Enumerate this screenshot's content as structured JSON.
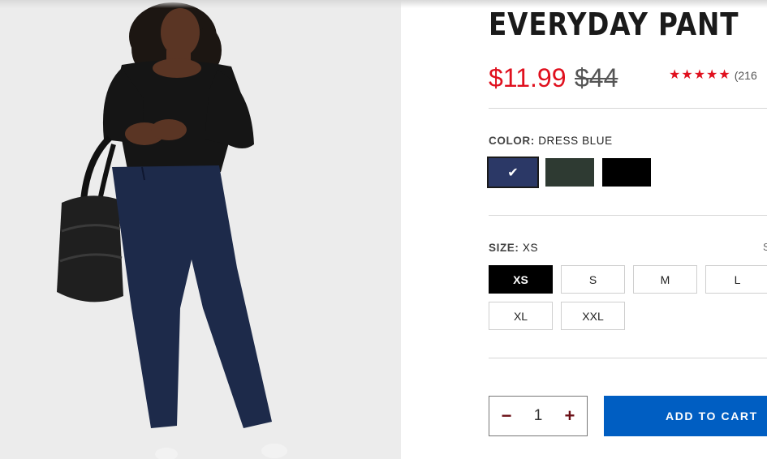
{
  "product": {
    "title": "EVERYDAY PANT",
    "sale_price": "$11.99",
    "original_price": "$44",
    "rating_stars": 5,
    "review_count": "(216"
  },
  "color": {
    "label": "COLOR:",
    "selected": "DRESS BLUE",
    "swatches": [
      {
        "name": "Dress Blue",
        "hex": "#2b3866",
        "selected": true
      },
      {
        "name": "Dark Green",
        "hex": "#2e3a32",
        "selected": false
      },
      {
        "name": "Black",
        "hex": "#000000",
        "selected": false
      }
    ]
  },
  "size": {
    "label": "SIZE:",
    "selected": "XS",
    "options": [
      "XS",
      "S",
      "M",
      "L",
      "XL",
      "XXL"
    ],
    "guide_hint": "S"
  },
  "quantity": {
    "value": "1",
    "minus": "−",
    "plus": "+"
  },
  "cart": {
    "add_label": "ADD TO CART"
  },
  "colors": {
    "sale_red": "#e0101e",
    "cta_blue": "#005ec2"
  }
}
